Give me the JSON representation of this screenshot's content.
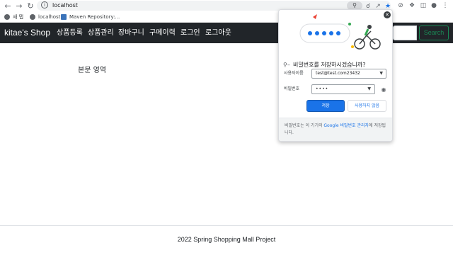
{
  "browser": {
    "url": "localhost",
    "bookmarks": [
      {
        "label": "새 탭",
        "color": "#5f6368"
      },
      {
        "label": "localhost",
        "color": "#5f6368"
      },
      {
        "label": "Maven Repository:...",
        "color": "#3b73b9"
      }
    ]
  },
  "navbar": {
    "brand": "kitae's Shop",
    "links": [
      "상품등록",
      "상품관리",
      "장바구니",
      "구메이력",
      "로그인",
      "로그아웃"
    ],
    "search_button": "Search"
  },
  "main": {
    "content_text": "본문 영역"
  },
  "footer": {
    "text": "2022 Spring Shopping Mall Project"
  },
  "password_popup": {
    "title": "비밀번호를 저장하시겠습니까?",
    "username_label": "사용자이름",
    "username_value": "test@test.com23432",
    "password_label": "비밀번호",
    "password_value": "••••",
    "save_button": "저장",
    "never_button": "사용하지 않음",
    "footer_prefix": "비밀번호는 이 기기의 ",
    "footer_link": "Google 비밀번호 관리자",
    "footer_suffix": "에 저장됩니다."
  },
  "colors": {
    "navbar_bg": "#212529",
    "search_accent": "#198754",
    "save_button_bg": "#1a73e8"
  }
}
